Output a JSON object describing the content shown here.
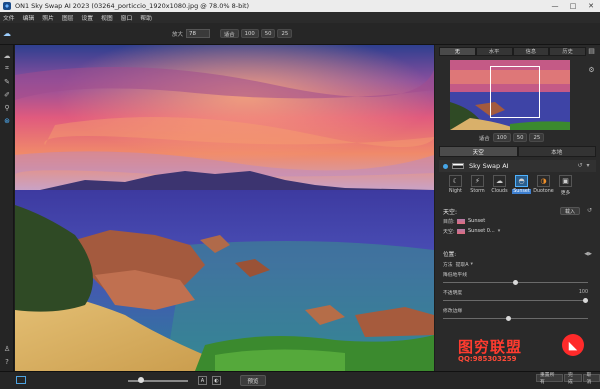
{
  "window": {
    "title": "ON1 Sky Swap AI 2023 (03264_porticcio_1920x1080.jpg @ 78.0% 8-bit)",
    "controls": [
      "—",
      "□",
      "✕"
    ]
  },
  "menu": [
    "文件",
    "编辑",
    "照片",
    "图层",
    "设置",
    "视图",
    "窗口",
    "帮助"
  ],
  "toolbar": {
    "zoom_label": "放大",
    "zoom_value": "78",
    "fit_label": "适合",
    "fit_options": [
      "100",
      "50",
      "25"
    ]
  },
  "left_tools": [
    {
      "icon": "view-icon",
      "glyph": "☁"
    },
    {
      "icon": "crop-icon",
      "glyph": "⌗"
    },
    {
      "icon": "brush-icon",
      "glyph": "✎"
    },
    {
      "icon": "pen-icon",
      "glyph": "✐"
    },
    {
      "icon": "retouch-icon",
      "glyph": "⚲"
    },
    {
      "icon": "sky-tool-icon",
      "glyph": "⊛"
    }
  ],
  "right_panel": {
    "view_tabs": [
      "无",
      "水平",
      "信息",
      "历史"
    ],
    "navigator_fit_label": "适合",
    "navigator_fit_options": [
      "100",
      "50",
      "25"
    ],
    "mode_tabs": [
      "天空",
      "本地"
    ],
    "module_title": "Sky Swap AI",
    "presets": [
      {
        "name": "Night",
        "glyph": "☾"
      },
      {
        "name": "Storm",
        "glyph": "⚡"
      },
      {
        "name": "Clouds",
        "glyph": "☁"
      },
      {
        "name": "Sunset",
        "glyph": "◓",
        "selected": true
      },
      {
        "name": "Duotone",
        "glyph": "◑"
      },
      {
        "name": "更多",
        "glyph": "▣"
      }
    ],
    "sky": {
      "heading": "天空:",
      "load_button": "载入",
      "rows": [
        {
          "key": "目前:",
          "value": "Sunset"
        },
        {
          "key": "天空:",
          "value": "Sunset 0..."
        }
      ]
    },
    "adjust": {
      "heading": "位置:",
      "rows": [
        {
          "label": "方法",
          "value": "提取A"
        },
        {
          "label": "降低地平线",
          "value": ""
        },
        {
          "label": "不透明度",
          "value": "100"
        },
        {
          "label": "修改边缘",
          "value": ""
        }
      ],
      "slider_levels": [
        0.5,
        1.0,
        0.45
      ]
    },
    "bottom_buttons": [
      "重置所有",
      "完成",
      "取消"
    ]
  },
  "bottom_bar": {
    "reset_label": "预览",
    "small_buttons": [
      "A",
      "◐"
    ]
  },
  "watermark": {
    "title": "图穷联盟",
    "subtitle": "QQ:985303259",
    "logo_glyph": "◣"
  },
  "colors": {
    "accent": "#4fb3ff",
    "preset_selected": "#3d7fd0",
    "watermark": "#ff3b2f"
  }
}
